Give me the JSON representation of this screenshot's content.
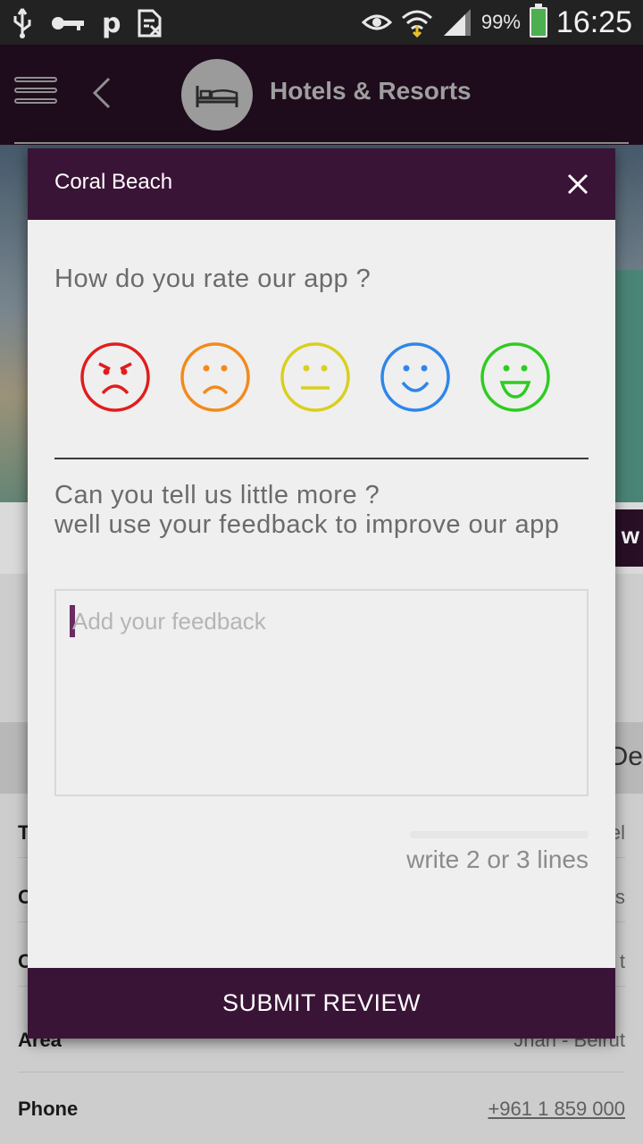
{
  "status_bar": {
    "battery_percent": "99%",
    "time": "16:25",
    "icons": [
      "usb-icon",
      "key-icon",
      "p-icon",
      "sim-icon",
      "eye-icon",
      "wifi-icon",
      "signal-icon",
      "battery-icon"
    ]
  },
  "app_bar": {
    "title": "Hotels & Resorts",
    "icons": [
      "menu-icon",
      "back-icon",
      "bed-icon"
    ]
  },
  "background": {
    "band_text": "De",
    "strip_button_text": "w",
    "rows": [
      {
        "label": "T",
        "value": "el"
      },
      {
        "label": "C",
        "value": "s"
      },
      {
        "label": "C",
        "value": "t"
      },
      {
        "label": "Area",
        "value": "Jnah - Beirut"
      },
      {
        "label": "Phone",
        "value": "+961 1 859 000"
      }
    ]
  },
  "dialog": {
    "title": "Coral Beach",
    "question": "How do you rate our app ?",
    "faces": [
      {
        "name": "angry",
        "color": "#e11d1d"
      },
      {
        "name": "sad",
        "color": "#f28a1c"
      },
      {
        "name": "neutral",
        "color": "#d9cf1e"
      },
      {
        "name": "smile",
        "color": "#2f86e8"
      },
      {
        "name": "happy",
        "color": "#2ecc1f"
      }
    ],
    "more_line1": "Can you tell us little more ?",
    "more_line2": "well use your feedback to improve our app",
    "feedback_placeholder": "Add your feedback",
    "feedback_value": "",
    "hint": "write 2 or 3 lines",
    "submit_label": "SUBMIT REVIEW"
  },
  "colors": {
    "header": "#3a1436",
    "appbar": "#1e0b1c",
    "dialog_bg": "#efefef"
  }
}
